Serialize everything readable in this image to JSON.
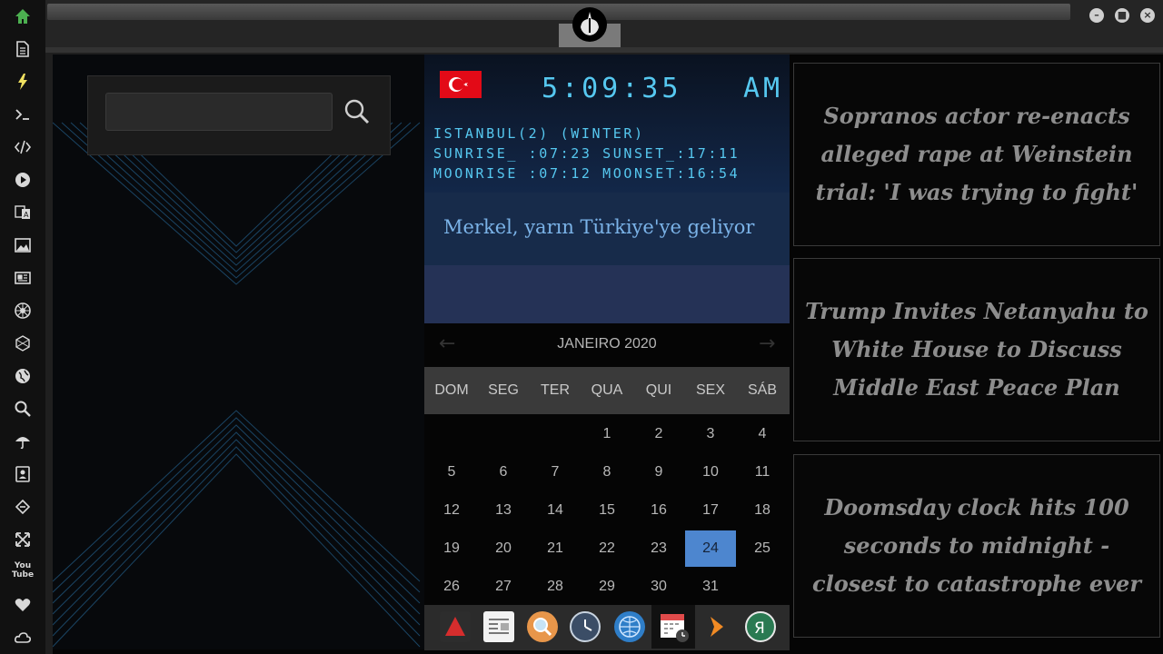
{
  "sidebar": {
    "icons": [
      "home-icon",
      "document-icon",
      "lightning-icon",
      "terminal-icon",
      "code-icon",
      "play-icon",
      "translate-icon",
      "image-icon",
      "newspaper-icon",
      "empire-icon",
      "rebel-icon",
      "globe-icon",
      "search-icon",
      "umbrella-icon",
      "contacts-icon",
      "tag-icon",
      "expand-icon",
      "youtube-icon",
      "heart-icon",
      "cloud-icon"
    ],
    "youtube_label": "You Tube",
    "accent": "#4caf50"
  },
  "window": {
    "buttons": [
      "minimize",
      "maximize",
      "close"
    ]
  },
  "search": {
    "value": "",
    "placeholder": ""
  },
  "clock": {
    "time": "5:09:35",
    "ampm": "AM",
    "line1": "ISTANBUL(2) (WINTER)",
    "line2": "SUNRISE_ :07:23 SUNSET_:17:11",
    "line3": "MOONRISE :07:12 MOONSET:16:54"
  },
  "ticker": {
    "text": "Merkel, yarın Türkiye'ye geliyor"
  },
  "calendar": {
    "month": "JANEIRO 2020",
    "weekdays": [
      "DOM",
      "SEG",
      "TER",
      "QUA",
      "QUI",
      "SEX",
      "SÁB"
    ],
    "weeks": [
      [
        "",
        "",
        "",
        "1",
        "2",
        "3",
        "4"
      ],
      [
        "5",
        "6",
        "7",
        "8",
        "9",
        "10",
        "11"
      ],
      [
        "12",
        "13",
        "14",
        "15",
        "16",
        "17",
        "18"
      ],
      [
        "19",
        "20",
        "21",
        "22",
        "23",
        "24",
        "25"
      ],
      [
        "26",
        "27",
        "28",
        "29",
        "30",
        "31",
        ""
      ]
    ],
    "today": "24"
  },
  "dock": {
    "apps": [
      "triangle-app-icon",
      "news-app-icon",
      "search-app-icon",
      "clock-app-icon",
      "browser-app-icon",
      "calendar-app-icon",
      "media-app-icon",
      "yandex-app-icon"
    ]
  },
  "headlines": [
    "Sopranos actor re-enacts alleged rape at Weinstein trial: 'I was trying to fight'",
    "Trump Invites Netanyahu to White House to Discuss Middle East Peace Plan",
    "Doomsday clock hits 100 seconds to midnight - closest to catastrophe ever"
  ]
}
